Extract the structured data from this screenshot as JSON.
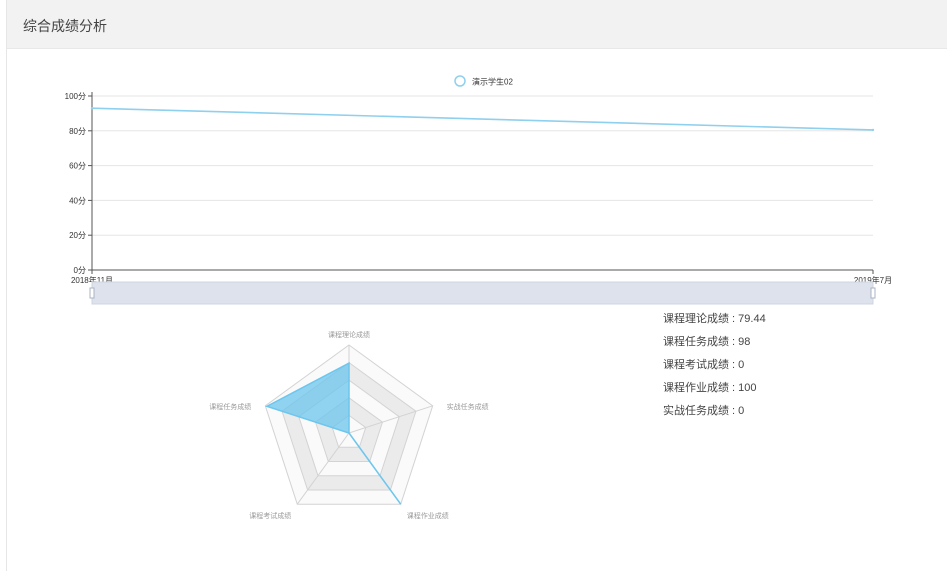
{
  "panel": {
    "title": "综合成绩分析"
  },
  "colors": {
    "line": "#8fd0ee",
    "radar_fill": "#6cc6ee",
    "grid": "#e5e5e5",
    "axis": "#555555",
    "slider_fill": "#dde2ec"
  },
  "chart_data": [
    {
      "type": "line",
      "legend": [
        "演示学生02"
      ],
      "legend_position": "top-center",
      "x": [
        "2018年11月",
        "2019年7月"
      ],
      "series": [
        {
          "name": "演示学生02",
          "values": [
            93,
            80.5
          ]
        }
      ],
      "y_ticks": [
        "0分",
        "20分",
        "40分",
        "60分",
        "80分",
        "100分"
      ],
      "ylim": [
        0,
        100
      ],
      "grid": true,
      "data_zoom": true
    },
    {
      "type": "radar",
      "indicators": [
        "课程理论成绩",
        "实战任务成绩",
        "课程作业成绩",
        "课程考试成绩",
        "课程任务成绩"
      ],
      "max": 100,
      "values": [
        79.44,
        0,
        100,
        0,
        98
      ]
    }
  ],
  "scores": [
    {
      "label": "课程理论成绩",
      "value": "79.44"
    },
    {
      "label": "课程任务成绩",
      "value": "98"
    },
    {
      "label": "课程考试成绩",
      "value": "0"
    },
    {
      "label": "课程作业成绩",
      "value": "100"
    },
    {
      "label": "实战任务成绩",
      "value": "0"
    }
  ]
}
